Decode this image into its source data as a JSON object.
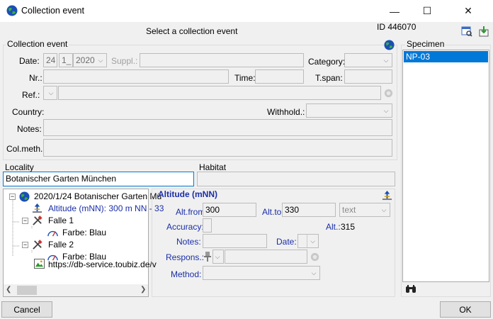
{
  "window": {
    "title": "Collection event",
    "minimize": "—",
    "maximize": "☐",
    "close": "✕"
  },
  "header": {
    "subtitle": "Select a collection event",
    "id_text": "ID 446070"
  },
  "collection_event": {
    "group_label": "Collection event",
    "date_label": "Date:",
    "day": "24",
    "month": "1_",
    "year": "2020",
    "suppl_label": "Suppl.:",
    "category_label": "Category:",
    "nr_label": "Nr.:",
    "time_label": "Time:",
    "tspan_label": "T.span:",
    "ref_label": "Ref.:",
    "country_label": "Country:",
    "withhold_label": "Withhold.:",
    "notes_label": "Notes:",
    "colmeth_label": "Col.meth.:"
  },
  "locality": {
    "label": "Locality",
    "value": "Botanischer Garten München"
  },
  "habitat": {
    "label": "Habitat",
    "value": ""
  },
  "tree": {
    "root": "2020/1/24 Botanischer Garten Mü",
    "altitude": "Altitude (mNN): 300 m NN - 33",
    "falle1": "Falle 1",
    "farbe1": "Farbe: Blau",
    "falle2": "Falle 2",
    "farbe2": "Farbe: Blau",
    "url": "https://db-service.toubiz.de/v"
  },
  "altitude_panel": {
    "title": "Altitude (mNN)",
    "alt_from_label": "Alt.from",
    "alt_from": "300",
    "alt_to_label": "Alt.to",
    "alt_to": "330",
    "unit": "text",
    "accuracy_label": "Accuracy:",
    "alt_label": "Alt.:",
    "alt_value": "315",
    "notes_label": "Notes:",
    "date_label": "Date:",
    "respons_label": "Respons.:",
    "method_label": "Method:"
  },
  "specimen": {
    "label": "Specimen",
    "items": [
      "NP-03"
    ]
  },
  "footer": {
    "cancel": "Cancel",
    "ok": "OK"
  },
  "colors": {
    "selection": "#0078d7",
    "title_blue": "#1a2ea8"
  }
}
